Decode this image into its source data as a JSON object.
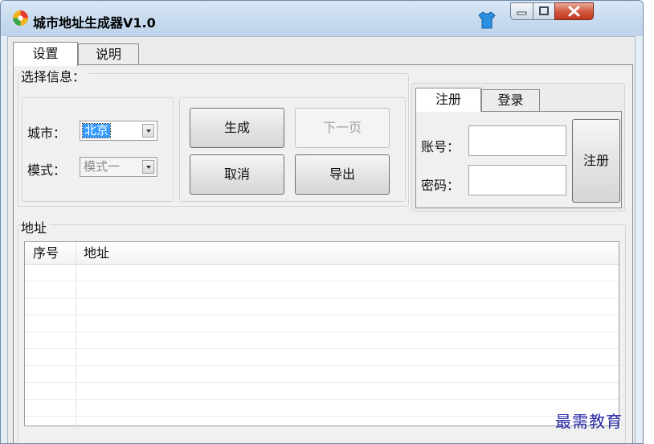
{
  "window": {
    "title": "城市地址生成器V1.0",
    "icons": {
      "app": "app-logo-icon",
      "skin": "shirt-skin-icon",
      "minimize": "minimize-icon",
      "maximize": "maximize-icon",
      "close": "close-icon"
    },
    "colors": {
      "close_button": "#d0543a",
      "selection": "#3399ff",
      "watermark": "#2a2aa8"
    }
  },
  "tabs": [
    {
      "label": "设置",
      "active": true
    },
    {
      "label": "说明",
      "active": false
    }
  ],
  "select_group": {
    "title": "选择信息：",
    "city_label": "城市：",
    "city_value": "北京",
    "mode_label": "模式：",
    "mode_value": "模式一"
  },
  "actions": {
    "generate": "生成",
    "next_page": "下一页",
    "cancel": "取消",
    "export": "导出"
  },
  "auth": {
    "tabs": [
      {
        "label": "注册",
        "active": true
      },
      {
        "label": "登录",
        "active": false
      }
    ],
    "account_label": "账号：",
    "account_value": "",
    "password_label": "密码：",
    "password_value": "",
    "register_button": "注册"
  },
  "address_group": {
    "title": "地址",
    "columns": [
      "序号",
      "地址"
    ],
    "rows": []
  },
  "watermark": "最需教育"
}
